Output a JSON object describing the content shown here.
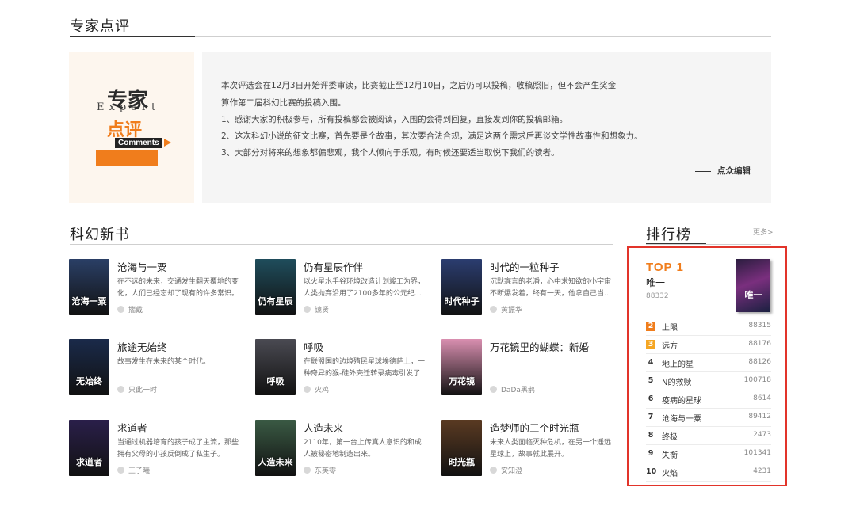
{
  "expert_section": {
    "title": "专家点评",
    "badge": {
      "cn_top": "专家",
      "en": "Expert",
      "cn_bottom": "点评",
      "en_bottom": "Comments"
    },
    "lines": [
      "本次评选会在12月3日开始评委审读，比赛截止至12月10日，之后仍可以投稿，收稿照旧，但不会产生奖金",
      "算作第二届科幻比赛的投稿入围。",
      "1、感谢大家的积极参与，所有投稿都会被阅读，入围的会得到回复，直接发到你的投稿邮箱。",
      "2、这次科幻小说的征文比赛，首先要是个故事，其次要合法合规，满足这两个需求后再谈文学性故事性和想象力。",
      "3、大部分对将来的想象都偏悲观，我个人倾向于乐观，有时候还要适当取悦下我们的读者。"
    ],
    "signature": "点众编辑"
  },
  "new_books": {
    "title": "科幻新书",
    "books": [
      {
        "title": "沧海与一粟",
        "desc": "在不远的未来，交通发生翻天覆地的变化，人们已经忘却了现有的许多常识。",
        "author": "揣戴",
        "cover_text": "沧海一粟",
        "cover_bg": "#2a3f66"
      },
      {
        "title": "仍有星辰作伴",
        "desc": "以火星水手谷环境改造计划竣工为界，人类抛弃沿用了2100多年的公元纪…",
        "author": "镜贤",
        "cover_text": "仍有星辰",
        "cover_bg": "#1f4d5c"
      },
      {
        "title": "时代的一粒种子",
        "desc": "沉默寡言的老潘，心中求知欲的小宇宙不断爆发着，终有一天，他拿自己当…",
        "author": "黄振华",
        "cover_text": "时代种子",
        "cover_bg": "#2b3d70"
      },
      {
        "title": "旅途无始终",
        "desc": "故事发生在未来的某个时代。",
        "author": "只此一时",
        "cover_text": "无始终",
        "cover_bg": "#1a2a4a"
      },
      {
        "title": "呼吸",
        "desc": "在联盟国的边境殖民星球埃德萨上，一种奇异的猴-硅外壳迁转录病毒引发了席",
        "author": "火鸡",
        "cover_text": "呼吸",
        "cover_bg": "#4a4a52"
      },
      {
        "title": "万花镜里的蝴蝶：新婚",
        "desc": "",
        "author": "DaDa黑鹊",
        "cover_text": "万花镜",
        "cover_bg": "#d98fb0"
      },
      {
        "title": "求道者",
        "desc": "当通过机器培育的孩子成了主流，那些拥有父母的小孩反倒成了私生子。",
        "author": "王子曦",
        "cover_text": "求道者",
        "cover_bg": "#2a1f4a"
      },
      {
        "title": "人造未来",
        "desc": "2110年，第一台上传真人意识的和成人被秘密地制造出来。",
        "author": "东英零",
        "cover_text": "人造未来",
        "cover_bg": "#3a5a44"
      },
      {
        "title": "造梦师的三个时光瓶",
        "desc": "未来人类面临灭种危机，在另一个遥远星球上，故事就此展开。",
        "author": "安知澄",
        "cover_text": "时光瓶",
        "cover_bg": "#5a3a22"
      }
    ]
  },
  "ranking": {
    "title": "排行榜",
    "more": "更多>",
    "top1": {
      "label": "TOP 1",
      "title": "唯一",
      "count": "88332",
      "cover_text": "唯一"
    },
    "items": [
      {
        "rank": "2",
        "title": "上限",
        "count": "88315"
      },
      {
        "rank": "3",
        "title": "远方",
        "count": "88176"
      },
      {
        "rank": "4",
        "title": "地上的星",
        "count": "88126"
      },
      {
        "rank": "5",
        "title": "N的救赎",
        "count": "100718"
      },
      {
        "rank": "6",
        "title": "疫病的星球",
        "count": "8614"
      },
      {
        "rank": "7",
        "title": "沧海与一粟",
        "count": "89412"
      },
      {
        "rank": "8",
        "title": "终极",
        "count": "2473"
      },
      {
        "rank": "9",
        "title": "失衡",
        "count": "101341"
      },
      {
        "rank": "10",
        "title": "火焰",
        "count": "4231"
      }
    ]
  }
}
